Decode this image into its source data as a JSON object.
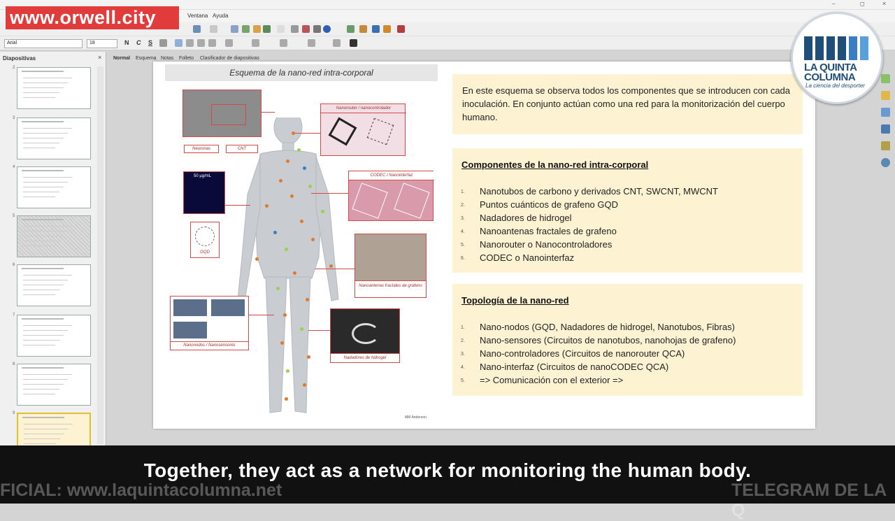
{
  "brand": {
    "watermark": "www.orwell.city"
  },
  "logo": {
    "line1": "LA QUINTA",
    "line2": "COLUMNA",
    "tagline": "La ciencia del desporter"
  },
  "menu": {
    "ventana": "Ventana",
    "ayuda": "Ayuda"
  },
  "format": {
    "font": "Arial",
    "size": "18",
    "bold": "N",
    "italic": "C",
    "underline": "S"
  },
  "panel": {
    "title": "Diapositivas",
    "close": "×",
    "slide_numbers": [
      "",
      "2",
      "3",
      "4",
      "5",
      "6",
      "7",
      "8",
      "9"
    ]
  },
  "viewtabs": [
    "Normal",
    "Esquema",
    "Notas",
    "Folleto",
    "Clasificador de diapositivas"
  ],
  "slide": {
    "scheme_title": "Esquema de la nano-red intra-corporal",
    "intro": "En este esquema se observa todos los componentes que se introducen con cada inoculación. En conjunto actúan como una red para la monitorización del cuerpo humano.",
    "components_title": "Componentes de la nano-red intra-corporal",
    "components": [
      {
        "n": "1.",
        "text": "Nanotubos de carbono y derivados CNT, SWCNT, MWCNT"
      },
      {
        "n": "2.",
        "text": "Puntos cuánticos de grafeno GQD"
      },
      {
        "n": "3.",
        "text": "Nadadores de hidrogel"
      },
      {
        "n": "4.",
        "text": "Nanoantenas fractales de grafeno"
      },
      {
        "n": "5.",
        "text": "Nanorouter o Nanocontroladores"
      },
      {
        "n": "6.",
        "text": "CODEC o Nanointerfaz"
      }
    ],
    "topology_title": "Topología de la nano-red",
    "topology": [
      {
        "n": "1.",
        "text": "Nano-nodos (GQD, Nadadores de hidrogel, Nanotubos, Fibras)"
      },
      {
        "n": "2.",
        "text": "Nano-sensores (Circuitos de nanotubos, nanohojas de grafeno)"
      },
      {
        "n": "3.",
        "text": "Nano-controladores (Circuitos de nanorouter QCA)"
      },
      {
        "n": "4.",
        "text": "Nano-interfaz (Circuitos de nanoCODEC QCA)"
      },
      {
        "n": "5.",
        "text": "=> Comunicación con el exterior =>"
      }
    ],
    "diagram_labels": {
      "neuronas": "Neuronas",
      "cnt": "CNT",
      "nanorouter": "Nanorouter / nanocontrolador",
      "codec": "CODEC / Nanointerfaz",
      "concentration": "50 µg/mL",
      "gqd": "GQD",
      "nanoantenas": "Nanoantenas fractales de grafeno",
      "nanonodos": "Nanonodos / Nanosensores",
      "nadadores": "Nadadores de hidrogel",
      "credit": "MM Anderson"
    }
  },
  "subtitle": "Together, they act as a network for monitoring the human body.",
  "ticker": {
    "left": "FICIAL: www.laquintacolumna.net",
    "right": "TELEGRAM DE LA Q"
  },
  "colors": {
    "accent_red": "#d24a4a",
    "box_bg": "#fdf3d3",
    "brand_red": "#e13b3b",
    "logo_blue": "#1f4e78"
  }
}
